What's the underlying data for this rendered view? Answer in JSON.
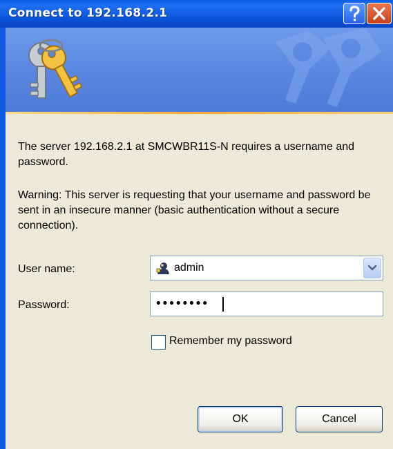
{
  "window": {
    "title": "Connect to 192.168.2.1"
  },
  "message": {
    "line1": "The server 192.168.2.1 at SMCWBR11S-N requires a username and password.",
    "warning": "Warning: This server is requesting that your username and password be sent in an insecure manner (basic authentication without a secure connection)."
  },
  "form": {
    "username_label": "User name:",
    "username_value": "admin",
    "password_label": "Password:",
    "password_value": "••••••••",
    "remember_label": "Remember my password",
    "remember_checked": false
  },
  "buttons": {
    "ok": "OK",
    "cancel": "Cancel"
  },
  "icons": {
    "banner": "keys-icon",
    "user": "user-icon",
    "dropdown": "chevron-down-icon",
    "help": "help-icon",
    "close": "close-icon"
  },
  "colors": {
    "titlebar": "#0a53d8",
    "banner": "#5886e0",
    "dialog_bg": "#ece9d8",
    "close_button": "#d1542c"
  }
}
